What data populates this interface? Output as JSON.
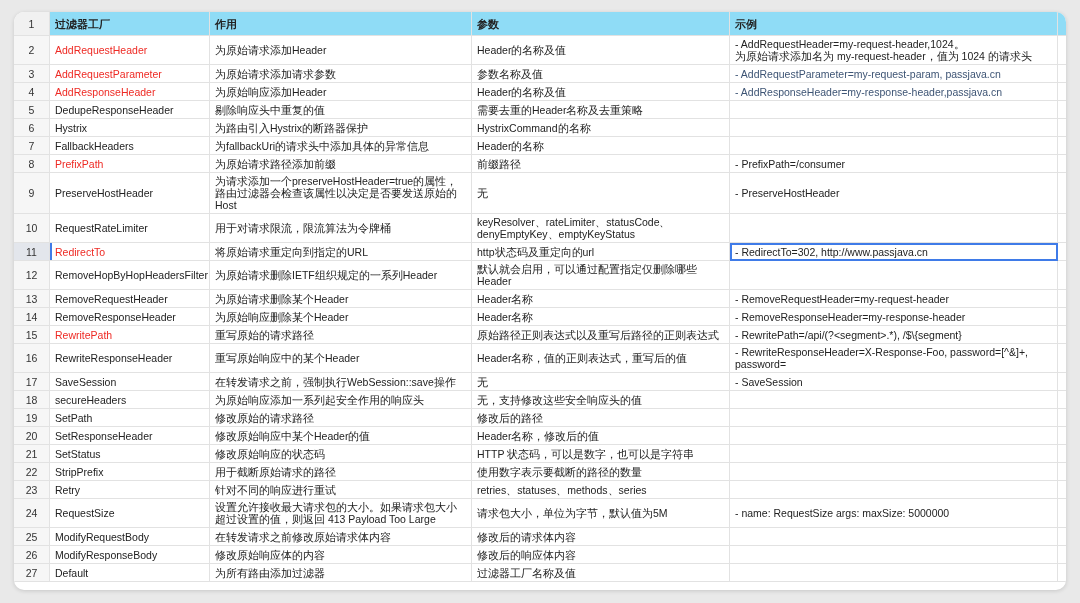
{
  "header": {
    "number": "1",
    "columns": [
      "过滤器工厂",
      "作用",
      "参数",
      "示例"
    ]
  },
  "rows": [
    {
      "number": "2",
      "selected": false,
      "name": {
        "text": "AddRequestHeader",
        "highlighted": true
      },
      "purpose": "为原始请求添加Header",
      "params": "Header的名称及值",
      "example": {
        "kind": "plain",
        "text": "- AddRequestHeader=my-request-header,1024。",
        "text2": "为原始请求添加名为 my-request-header，值为 1024 的请求头"
      }
    },
    {
      "number": "3",
      "selected": false,
      "name": {
        "text": "AddRequestParameter",
        "highlighted": true
      },
      "purpose": "为原始请求添加请求参数",
      "params": "参数名称及值",
      "example": {
        "kind": "link",
        "text": "- AddRequestParameter=my-request-param, passjava.cn"
      }
    },
    {
      "number": "4",
      "selected": false,
      "name": {
        "text": "AddResponseHeader",
        "highlighted": true
      },
      "purpose": "为原始响应添加Header",
      "params": "Header的名称及值",
      "example": {
        "kind": "link",
        "text": "- AddResponseHeader=my-response-header,passjava.cn"
      }
    },
    {
      "number": "5",
      "selected": false,
      "name": {
        "text": "DedupeResponseHeader",
        "highlighted": false
      },
      "purpose": "剔除响应头中重复的值",
      "params": "需要去重的Header名称及去重策略"
    },
    {
      "number": "6",
      "selected": false,
      "name": {
        "text": "Hystrix",
        "highlighted": false
      },
      "purpose": "为路由引入Hystrix的断路器保护",
      "params": "HystrixCommand的名称"
    },
    {
      "number": "7",
      "selected": false,
      "name": {
        "text": "FallbackHeaders",
        "highlighted": false
      },
      "purpose": "为fallbackUri的请求头中添加具体的异常信息",
      "params": "Header的名称"
    },
    {
      "number": "8",
      "selected": false,
      "name": {
        "text": "PrefixPath",
        "highlighted": true
      },
      "purpose": "为原始请求路径添加前缀",
      "params": "前缀路径",
      "example": {
        "kind": "plain",
        "text": "- PrefixPath=/consumer"
      }
    },
    {
      "number": "9",
      "selected": false,
      "name": {
        "text": "PreserveHostHeader",
        "highlighted": false
      },
      "purpose": "为请求添加一个preserveHostHeader=true的属性，路由过滤器会检查该属性以决定是否要发送原始的Host",
      "params": "无",
      "example": {
        "kind": "plain",
        "text": "- PreserveHostHeader"
      }
    },
    {
      "number": "10",
      "selected": false,
      "name": {
        "text": "RequestRateLimiter",
        "highlighted": false
      },
      "purpose": "用于对请求限流，限流算法为令牌桶",
      "params": "keyResolver、rateLimiter、statusCode、denyEmptyKey、emptyKeyStatus"
    },
    {
      "number": "11",
      "selected": true,
      "name": {
        "text": "RedirectTo",
        "highlighted": true
      },
      "purpose": "将原始请求重定向到指定的URL",
      "params": "http状态码及重定向的url",
      "example": {
        "kind": "plain",
        "text": "- RedirectTo=302, http://www.passjava.cn"
      }
    },
    {
      "number": "12",
      "selected": false,
      "name": {
        "text": "RemoveHopByHopHeadersFilter",
        "highlighted": false
      },
      "purpose": "为原始请求删除IETF组织规定的一系列Header",
      "params": "默认就会启用，可以通过配置指定仅删除哪些Header"
    },
    {
      "number": "13",
      "selected": false,
      "name": {
        "text": "RemoveRequestHeader",
        "highlighted": false
      },
      "purpose": "为原始请求删除某个Header",
      "params": "Header名称",
      "example": {
        "kind": "plain",
        "text": "- RemoveRequestHeader=my-request-header"
      }
    },
    {
      "number": "14",
      "selected": false,
      "name": {
        "text": "RemoveResponseHeader",
        "highlighted": false
      },
      "purpose": "为原始响应删除某个Header",
      "params": "Header名称",
      "example": {
        "kind": "plain",
        "text": "- RemoveResponseHeader=my-response-header"
      }
    },
    {
      "number": "15",
      "selected": false,
      "name": {
        "text": "RewritePath",
        "highlighted": true
      },
      "purpose": "重写原始的请求路径",
      "params": "原始路径正则表达式以及重写后路径的正则表达式",
      "example": {
        "kind": "plain",
        "text": "- RewritePath=/api/(?<segment>.*), /$\\{segment}"
      }
    },
    {
      "number": "16",
      "selected": false,
      "name": {
        "text": "RewriteResponseHeader",
        "highlighted": false
      },
      "purpose": "重写原始响应中的某个Header",
      "params": "Header名称，值的正则表达式，重写后的值",
      "example": {
        "kind": "plain",
        "text": "- RewriteResponseHeader=X-Response-Foo, password=[^&]+, password="
      }
    },
    {
      "number": "17",
      "selected": false,
      "name": {
        "text": "SaveSession",
        "highlighted": false
      },
      "purpose": "在转发请求之前，强制执行WebSession::save操作",
      "params": "无",
      "example": {
        "kind": "plain",
        "text": "- SaveSession"
      }
    },
    {
      "number": "18",
      "selected": false,
      "name": {
        "text": "secureHeaders",
        "highlighted": false
      },
      "purpose": "为原始响应添加一系列起安全作用的响应头",
      "params": "无，支持修改这些安全响应头的值"
    },
    {
      "number": "19",
      "selected": false,
      "name": {
        "text": "SetPath",
        "highlighted": false
      },
      "purpose": "修改原始的请求路径",
      "params": "修改后的路径"
    },
    {
      "number": "20",
      "selected": false,
      "name": {
        "text": "SetResponseHeader",
        "highlighted": false
      },
      "purpose": "修改原始响应中某个Header的值",
      "params": "Header名称，修改后的值"
    },
    {
      "number": "21",
      "selected": false,
      "name": {
        "text": "SetStatus",
        "highlighted": false
      },
      "purpose": "修改原始响应的状态码",
      "params": "HTTP 状态码，可以是数字，也可以是字符串"
    },
    {
      "number": "22",
      "selected": false,
      "name": {
        "text": "StripPrefix",
        "highlighted": false
      },
      "purpose": "用于截断原始请求的路径",
      "params": "使用数字表示要截断的路径的数量"
    },
    {
      "number": "23",
      "selected": false,
      "name": {
        "text": "Retry",
        "highlighted": false
      },
      "purpose": "针对不同的响应进行重试",
      "params": "retries、statuses、methods、series"
    },
    {
      "number": "24",
      "selected": false,
      "name": {
        "text": "RequestSize",
        "highlighted": false
      },
      "purpose": "设置允许接收最大请求包的大小。如果请求包大小超过设置的值，则返回 413 Payload Too Large",
      "params": "请求包大小，单位为字节，默认值为5M",
      "example": {
        "kind": "plain",
        "text": "- name: RequestSize args: maxSize: 5000000"
      }
    },
    {
      "number": "25",
      "selected": false,
      "name": {
        "text": "ModifyRequestBody",
        "highlighted": false
      },
      "purpose": "在转发请求之前修改原始请求体内容",
      "params": "修改后的请求体内容"
    },
    {
      "number": "26",
      "selected": false,
      "name": {
        "text": "ModifyResponseBody",
        "highlighted": false
      },
      "purpose": "修改原始响应体的内容",
      "params": "修改后的响应体内容"
    },
    {
      "number": "27",
      "selected": false,
      "name": {
        "text": "Default",
        "highlighted": false
      },
      "purpose": "为所有路由添加过滤器",
      "params": "过滤器工厂名称及值"
    }
  ]
}
